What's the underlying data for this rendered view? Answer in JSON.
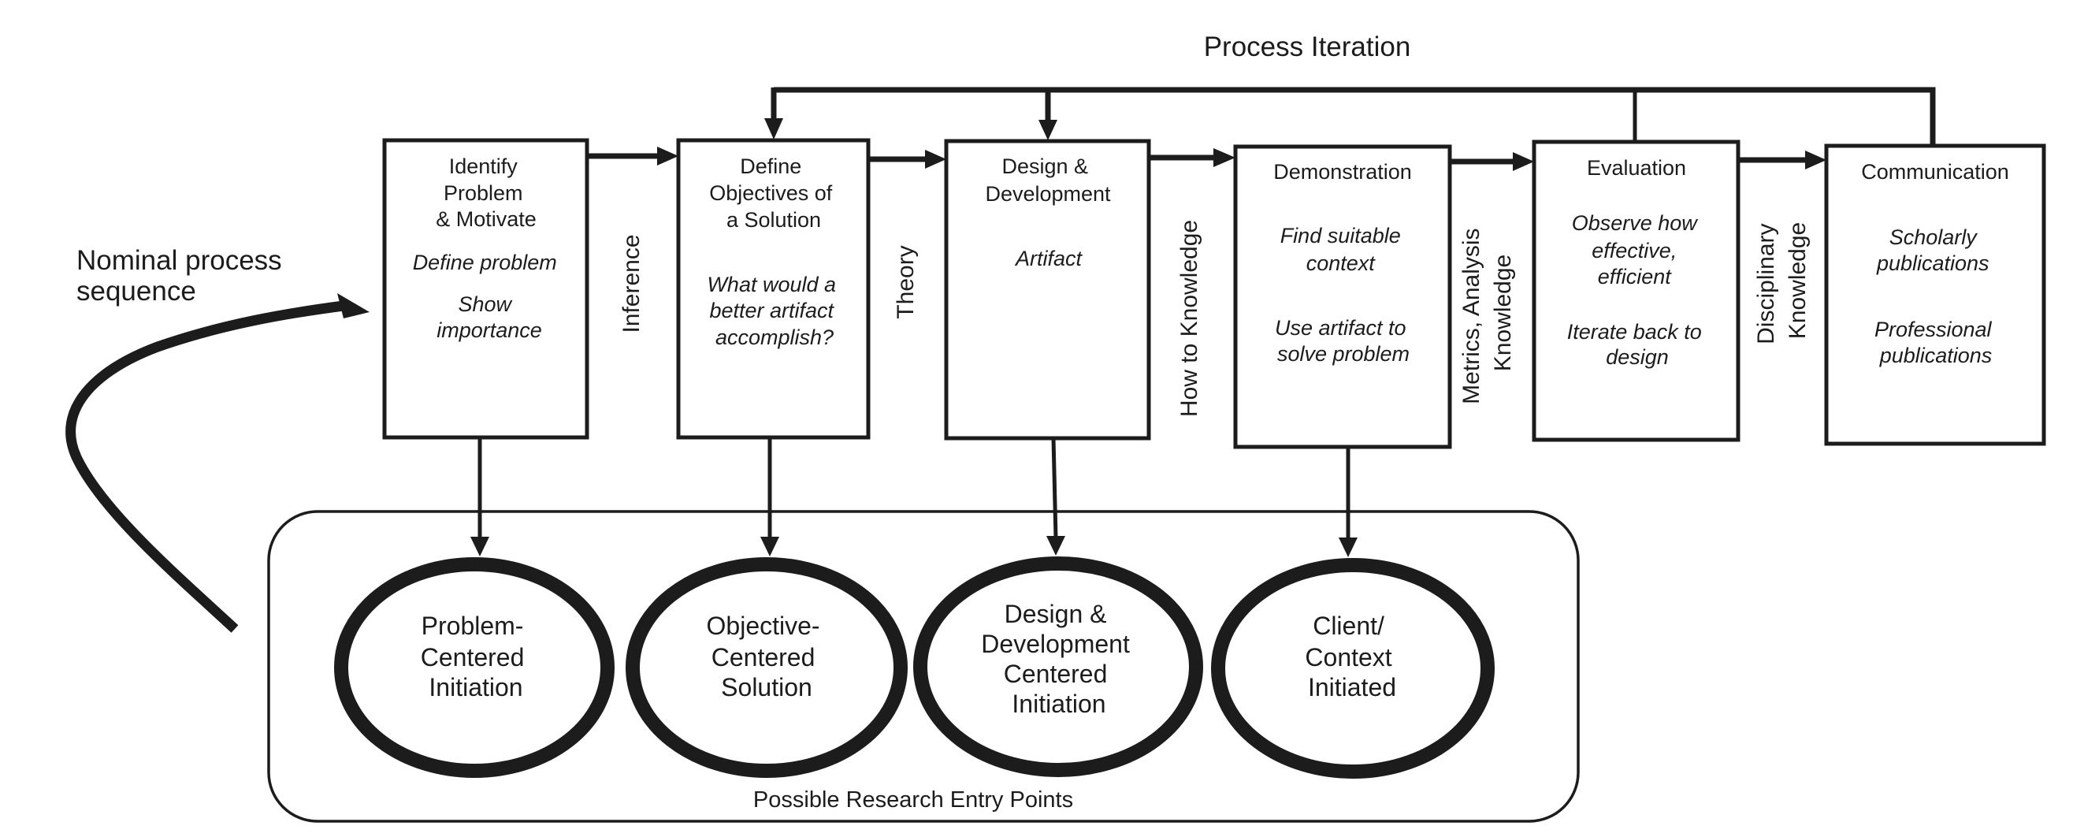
{
  "title": "Process Iteration",
  "nominal_label": [
    "Nominal process",
    "sequence"
  ],
  "steps": [
    {
      "heading": [
        "Identify",
        "Problem",
        "& Motivate"
      ],
      "activities": [
        "Define problem",
        "Show",
        "importance"
      ]
    },
    {
      "heading": [
        "Define",
        "Objectives of",
        "a Solution"
      ],
      "activities": [
        "What would a",
        "better artifact",
        "accomplish?"
      ]
    },
    {
      "heading": [
        "Design &",
        "Development"
      ],
      "activities": [
        "Artifact"
      ]
    },
    {
      "heading": [
        "Demonstration"
      ],
      "activities": [
        "Find suitable",
        "context",
        "Use artifact to",
        "solve problem"
      ]
    },
    {
      "heading": [
        "Evaluation"
      ],
      "activities": [
        "Observe how",
        "effective,",
        "efficient",
        "Iterate back to",
        "design"
      ]
    },
    {
      "heading": [
        "Communication"
      ],
      "activities": [
        "Scholarly",
        "publications",
        "Professional",
        "publications"
      ]
    }
  ],
  "transitions": [
    {
      "lines": [
        "Inference"
      ]
    },
    {
      "lines": [
        "Theory"
      ]
    },
    {
      "lines": [
        "How to Knowledge"
      ]
    },
    {
      "lines": [
        "Metrics, Analysis",
        "Knowledge"
      ]
    },
    {
      "lines": [
        "Disciplinary",
        "Knowledge"
      ]
    }
  ],
  "entry_points": {
    "label": "Possible Research Entry Points",
    "items": [
      {
        "lines": [
          "Problem-",
          "Centered",
          "Initiation"
        ]
      },
      {
        "lines": [
          "Objective-",
          "Centered",
          "Solution"
        ]
      },
      {
        "lines": [
          "Design &",
          "Development",
          "Centered",
          "Initiation"
        ]
      },
      {
        "lines": [
          "Client/",
          "Context",
          "Initiated"
        ]
      }
    ]
  },
  "colors": {
    "ink": "#1c1c1c",
    "background": "#ffffff"
  }
}
